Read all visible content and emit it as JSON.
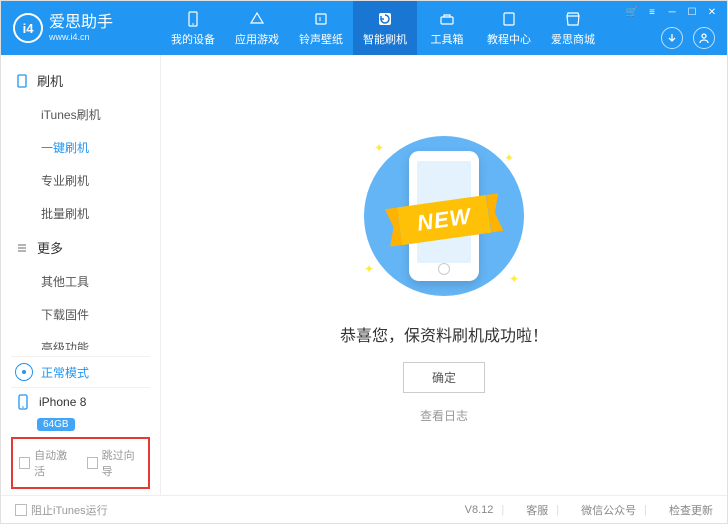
{
  "app": {
    "title": "爱思助手",
    "subtitle": "www.i4.cn",
    "logo_text": "i4"
  },
  "nav": [
    {
      "label": "我的设备",
      "icon": "device"
    },
    {
      "label": "应用游戏",
      "icon": "apps"
    },
    {
      "label": "铃声壁纸",
      "icon": "music"
    },
    {
      "label": "智能刷机",
      "icon": "refresh",
      "active": true
    },
    {
      "label": "工具箱",
      "icon": "toolbox"
    },
    {
      "label": "教程中心",
      "icon": "book"
    },
    {
      "label": "爱思商城",
      "icon": "store"
    }
  ],
  "sidebar": {
    "sections": [
      {
        "title": "刷机",
        "items": [
          "iTunes刷机",
          "一键刷机",
          "专业刷机",
          "批量刷机"
        ],
        "active_index": 1
      },
      {
        "title": "更多",
        "items": [
          "其他工具",
          "下载固件",
          "高级功能"
        ]
      }
    ],
    "mode": "正常模式",
    "device": {
      "name": "iPhone 8",
      "storage": "64GB"
    },
    "options": [
      "自动激活",
      "跳过向导"
    ]
  },
  "main": {
    "banner_text": "NEW",
    "success_message": "恭喜您，保资料刷机成功啦！",
    "confirm_button": "确定",
    "log_link": "查看日志"
  },
  "footer": {
    "block_itunes": "阻止iTunes运行",
    "version": "V8.12",
    "links": [
      "客服",
      "微信公众号",
      "检查更新"
    ]
  }
}
